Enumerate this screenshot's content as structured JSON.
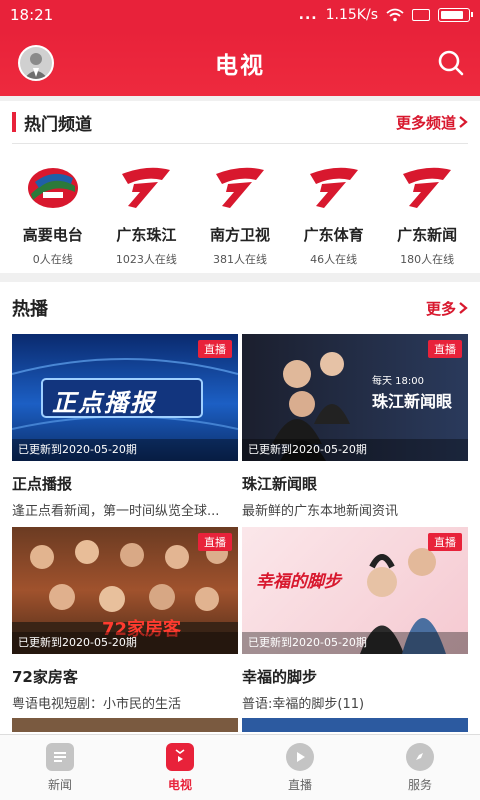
{
  "status_bar": {
    "time": "18:21",
    "dots": "...",
    "speed": "1.15K/s",
    "battery_level": 0.85
  },
  "header": {
    "title": "电视"
  },
  "hot_channels": {
    "title": "热门频道",
    "more": "更多频道",
    "channels": [
      {
        "name": "高要电台",
        "online": "0人在线",
        "logo": "gaoyao-logo"
      },
      {
        "name": "广东珠江",
        "online": "1023人在线",
        "logo": "gdtv-logo"
      },
      {
        "name": "南方卫视",
        "online": "381人在线",
        "logo": "gdtv-logo"
      },
      {
        "name": "广东体育",
        "online": "46人在线",
        "logo": "gdtv-logo"
      },
      {
        "name": "广东新闻",
        "online": "180人在线",
        "logo": "gdtv-logo"
      }
    ]
  },
  "hot_play": {
    "title": "热播",
    "more": "更多",
    "live_label": "直播",
    "cards": [
      {
        "title": "正点播报",
        "desc": "逢正点看新闻，第一时间纵览全球...",
        "updated": "已更新到2020-05-20期",
        "thumb_text": "正点播报"
      },
      {
        "title": "珠江新闻眼",
        "desc": "最新鲜的广东本地新闻资讯",
        "updated": "已更新到2020-05-20期",
        "thumb_text": "珠江新闻眼",
        "thumb_sub": "每天 18:00"
      },
      {
        "title": "72家房客",
        "desc": "粤语电视短剧：小市民的生活",
        "updated": "已更新到2020-05-20期",
        "thumb_text": "72家房客"
      },
      {
        "title": "幸福的脚步",
        "desc": "普语:幸福的脚步(11)",
        "updated": "已更新到2020-05-20期",
        "thumb_text": "幸福的脚步"
      }
    ]
  },
  "tabs": [
    {
      "label": "新闻",
      "icon": "news-icon",
      "active": false
    },
    {
      "label": "电视",
      "icon": "tv-icon",
      "active": true
    },
    {
      "label": "直播",
      "icon": "play-icon",
      "active": false
    },
    {
      "label": "服务",
      "icon": "compass-icon",
      "active": false
    }
  ],
  "colors": {
    "accent": "#e8223a",
    "active_tab": "#e8223a",
    "inactive_tab": "#c4c4c4"
  }
}
